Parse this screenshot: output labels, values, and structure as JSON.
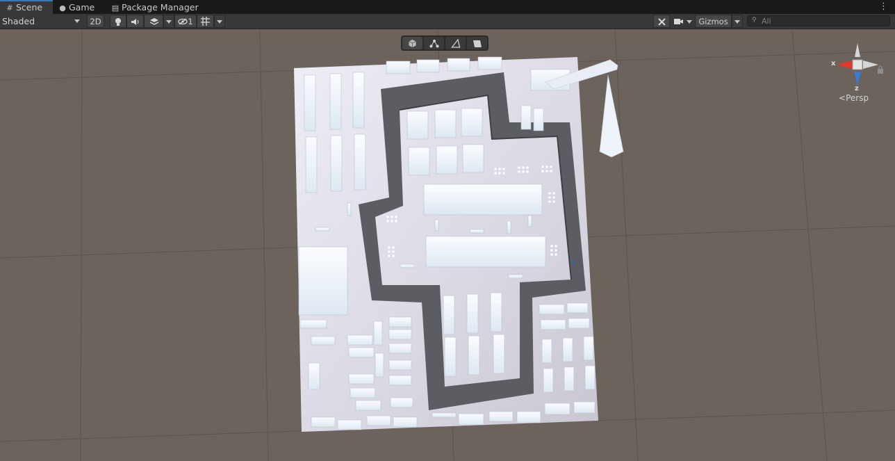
{
  "tabs": [
    {
      "label": "Scene",
      "icon": "grid-icon",
      "active": true
    },
    {
      "label": "Game",
      "icon": "gamepad-icon",
      "active": false
    },
    {
      "label": "Package Manager",
      "icon": "package-icon",
      "active": false
    }
  ],
  "toolbar": {
    "draw_mode": "Shaded",
    "mode_2d": "2D",
    "hidden_count": "1",
    "gizmos_label": "Gizmos",
    "search_placeholder": "All"
  },
  "scene_view": {
    "projection_label": "Persp",
    "axis_labels": {
      "x": "x",
      "z": "z"
    },
    "overlay_tools": [
      "cube-icon",
      "nodes-icon",
      "triangle-icon",
      "surface-icon"
    ],
    "colors": {
      "background": "#6b635c",
      "x_axis": "#e8372c",
      "y_axis": "#a6d86a",
      "z_axis": "#3a7bd5",
      "accent": "#3a79bb"
    }
  }
}
